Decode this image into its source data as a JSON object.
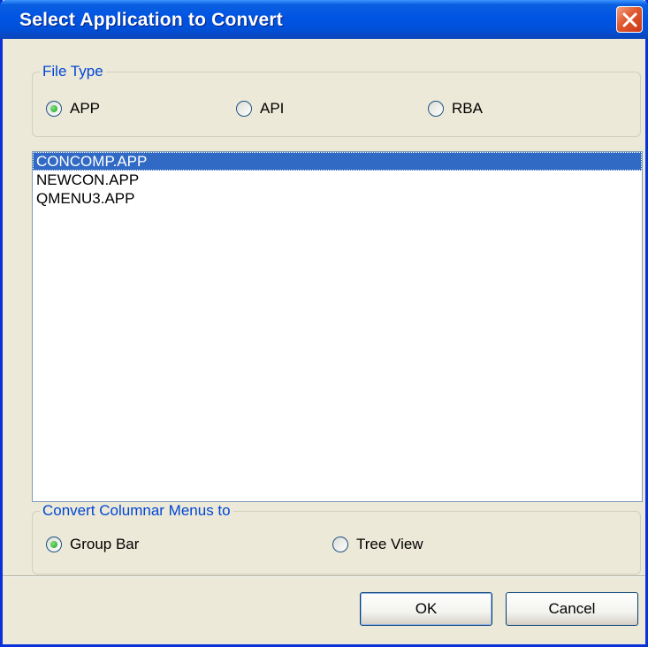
{
  "window": {
    "title": "Select Application to Convert"
  },
  "file_type": {
    "legend": "File Type",
    "options": [
      "APP",
      "API",
      "RBA"
    ],
    "selected": "APP"
  },
  "files": [
    "CONCOMP.APP",
    "NEWCON.APP",
    "QMENU3.APP"
  ],
  "selected_file": "CONCOMP.APP",
  "convert": {
    "legend": "Convert Columnar Menus to",
    "options": [
      "Group Bar",
      "Tree View"
    ],
    "selected": "Group Bar"
  },
  "buttons": {
    "ok": "OK",
    "cancel": "Cancel"
  },
  "icons": {
    "close": "close-icon"
  }
}
